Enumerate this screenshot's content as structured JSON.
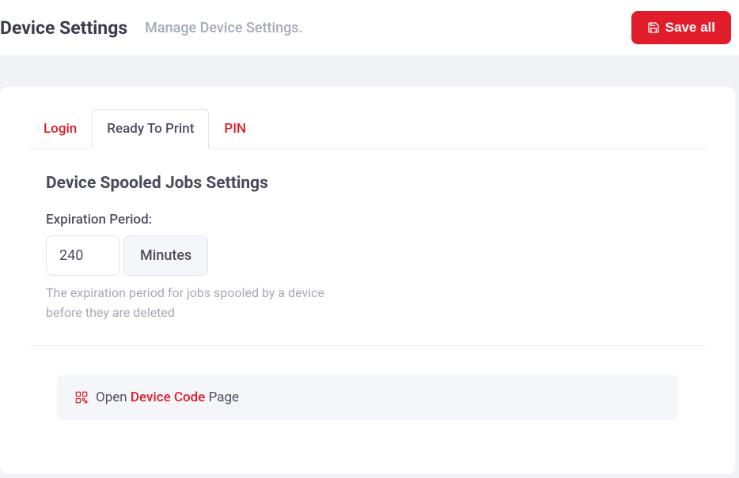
{
  "header": {
    "title": "Device Settings",
    "subtitle": "Manage Device Settings.",
    "save_label": "Save all"
  },
  "tabs": {
    "login": "Login",
    "ready_to_print": "Ready To Print",
    "pin": "PIN"
  },
  "section": {
    "title": "Device Spooled Jobs Settings",
    "expiration_label": "Expiration Period:",
    "expiration_value": "240",
    "expiration_unit": "Minutes",
    "help_text": "The expiration period for jobs spooled by a device before they are deleted"
  },
  "link_card": {
    "prefix": "Open ",
    "highlight": "Device Code",
    "suffix": " Page"
  }
}
